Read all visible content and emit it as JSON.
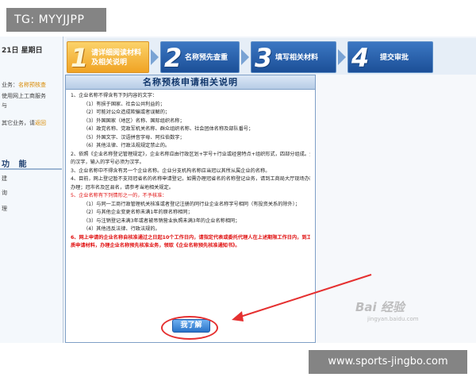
{
  "watermark_top": "TG: MYYJJPP",
  "watermark_bottom": "www.sports-jingbo.com",
  "baidu_watermark": "Bai 经验",
  "baidu_url": "jingyan.baidu.com",
  "sidebar": {
    "date": "21日  星期日",
    "lines": [
      {
        "text": "业务：",
        "highlight": "名称预核查"
      },
      {
        "text": "使用网上工商服务",
        "highlight": ""
      },
      {
        "text": "与",
        "highlight": ""
      },
      {
        "text": "其它业务，请",
        "highlight": "返回"
      }
    ],
    "functions_title": "功 能",
    "function_items": [
      "建",
      "询",
      "理"
    ]
  },
  "steps": [
    {
      "num": "1",
      "label": "请详细阅读材料及相关说明",
      "active": true
    },
    {
      "num": "2",
      "label": "名称预先查重",
      "active": false
    },
    {
      "num": "3",
      "label": "填写相关材料",
      "active": false
    },
    {
      "num": "4",
      "label": "提交审批",
      "active": false
    }
  ],
  "panel": {
    "title": "名称预核申请相关说明",
    "lines": [
      {
        "t": "1、企业名称不得含有下列内容的文字：",
        "ind": false,
        "cls": ""
      },
      {
        "t": "（1）有损于国家、社会公共利益的；",
        "ind": true,
        "cls": ""
      },
      {
        "t": "（2）可能对公众造成欺骗或者误解的；",
        "ind": true,
        "cls": ""
      },
      {
        "t": "（3）外国国家（地区）名称、国际组织名称；",
        "ind": true,
        "cls": ""
      },
      {
        "t": "（4）政党名称、党政军机关名称、群众组织名称、社会团体名称及部队番号；",
        "ind": true,
        "cls": ""
      },
      {
        "t": "（5）外国文字、汉语拼音字母、阿拉伯数字；",
        "ind": true,
        "cls": ""
      },
      {
        "t": "（6）其他法律、行政法规规定禁止的。",
        "ind": true,
        "cls": ""
      },
      {
        "t": "2、依照《企业名称登记管理规定》，企业名称应由行政区划+字号+行业或经营特点+组织形式，四部分组成。企业名称应当使用符合国家规范",
        "ind": false,
        "cls": ""
      },
      {
        "t": "的汉字，输入的字号必须为汉字。",
        "ind": false,
        "cls": ""
      },
      {
        "t": "3、企业名称中不得含有另一个企业名称。企业分支机构名称应当冠以其所从属企业的名称。",
        "ind": false,
        "cls": ""
      },
      {
        "t": "4、目前，网上登记暂不支持冠省名的名称申请登记，如需办理冠省名的名称登记业务，请到工商局大厅现场办理，或登录省局网上登记系统",
        "ind": false,
        "cls": ""
      },
      {
        "t": "办理；冠市名及区县名，请参考当地相关规定。",
        "ind": false,
        "cls": ""
      },
      {
        "t": "5、企业名称有下列情形之一的，不予核准：",
        "ind": false,
        "cls": "red"
      },
      {
        "t": "（1）与同一工商行政管理机关核准或者登记注册的同行业企业名称字号相同（有投资关系的除外）；",
        "ind": true,
        "cls": ""
      },
      {
        "t": "（2）与其他企业变更名称未满1年的原名称相同；",
        "ind": true,
        "cls": ""
      },
      {
        "t": "（3）与注销登记未满3年或者被吊销营业执照未满3年的企业名称相同；",
        "ind": true,
        "cls": ""
      },
      {
        "t": "（4）其他违反法律、行政法规的。",
        "ind": true,
        "cls": ""
      },
      {
        "t": "6、网上申请的企业名称自核准通过之日起10个工作日内，请指定代表或委托代理人在上述期限工作日内，到工商局办理现场核实纸",
        "ind": false,
        "cls": "red bold"
      },
      {
        "t": "质申请材料，办理企业名称预先核准业务，领取《企业名称预先核准通知书》。",
        "ind": false,
        "cls": "red bold"
      }
    ],
    "confirm_label": "我了解"
  }
}
